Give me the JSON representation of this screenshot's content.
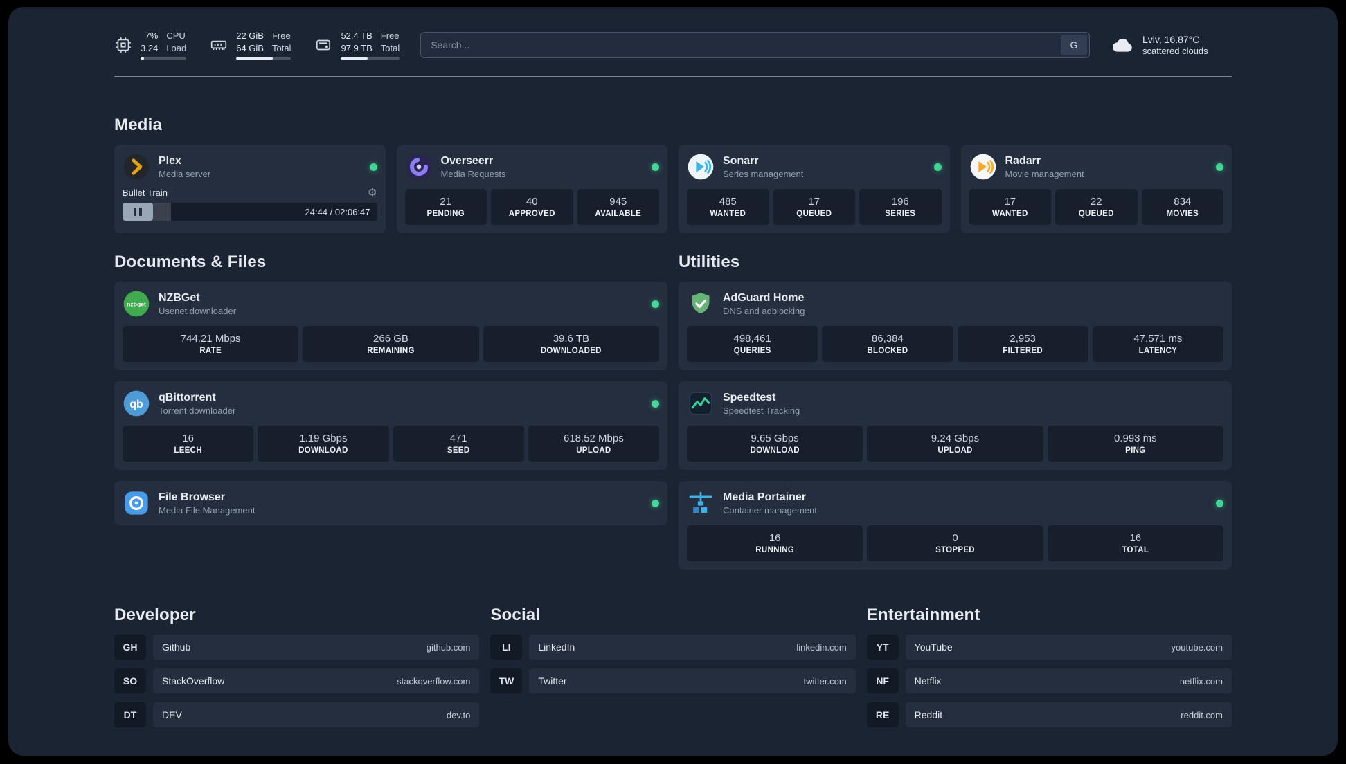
{
  "colors": {
    "online_dot": "#41d693",
    "plex_amber": "#e5a00d",
    "bar_fill": "#e9eef5"
  },
  "topbar": {
    "cpu": {
      "value_top": "7%",
      "value_bottom": "3.24",
      "label_top": "CPU",
      "label_bottom": "Load",
      "percent": 7
    },
    "memory": {
      "value_top": "22 GiB",
      "value_bottom": "64 GiB",
      "label_top": "Free",
      "label_bottom": "Total",
      "percent": 66
    },
    "disk": {
      "value_top": "52.4 TB",
      "value_bottom": "97.9 TB",
      "label_top": "Free",
      "label_bottom": "Total",
      "percent": 46
    },
    "search": {
      "placeholder": "Search...",
      "provider_label": "G"
    },
    "weather": {
      "location": "Lviv, 16.87°C",
      "condition": "scattered clouds"
    }
  },
  "sections": {
    "media": "Media",
    "documents": "Documents & Files",
    "utilities": "Utilities",
    "developer": "Developer",
    "social": "Social",
    "entertainment": "Entertainment"
  },
  "services": {
    "plex": {
      "name": "Plex",
      "desc": "Media server",
      "player": {
        "title": "Bullet Train",
        "time": "24:44 / 02:06:47",
        "progress": 19
      }
    },
    "overseerr": {
      "name": "Overseerr",
      "desc": "Media Requests",
      "stats": [
        {
          "value": "21",
          "label": "PENDING"
        },
        {
          "value": "40",
          "label": "APPROVED"
        },
        {
          "value": "945",
          "label": "AVAILABLE"
        }
      ]
    },
    "sonarr": {
      "name": "Sonarr",
      "desc": "Series management",
      "stats": [
        {
          "value": "485",
          "label": "WANTED"
        },
        {
          "value": "17",
          "label": "QUEUED"
        },
        {
          "value": "196",
          "label": "SERIES"
        }
      ]
    },
    "radarr": {
      "name": "Radarr",
      "desc": "Movie management",
      "stats": [
        {
          "value": "17",
          "label": "WANTED"
        },
        {
          "value": "22",
          "label": "QUEUED"
        },
        {
          "value": "834",
          "label": "MOVIES"
        }
      ]
    },
    "nzbget": {
      "name": "NZBGet",
      "desc": "Usenet downloader",
      "stats": [
        {
          "value": "744.21 Mbps",
          "label": "RATE"
        },
        {
          "value": "266 GB",
          "label": "REMAINING"
        },
        {
          "value": "39.6 TB",
          "label": "DOWNLOADED"
        }
      ]
    },
    "qbittorrent": {
      "name": "qBittorrent",
      "desc": "Torrent downloader",
      "stats": [
        {
          "value": "16",
          "label": "LEECH"
        },
        {
          "value": "1.19 Gbps",
          "label": "DOWNLOAD"
        },
        {
          "value": "471",
          "label": "SEED"
        },
        {
          "value": "618.52 Mbps",
          "label": "UPLOAD"
        }
      ]
    },
    "filebrowser": {
      "name": "File Browser",
      "desc": "Media File Management"
    },
    "adguard": {
      "name": "AdGuard Home",
      "desc": "DNS and adblocking",
      "stats": [
        {
          "value": "498,461",
          "label": "QUERIES"
        },
        {
          "value": "86,384",
          "label": "BLOCKED"
        },
        {
          "value": "2,953",
          "label": "FILTERED"
        },
        {
          "value": "47.571 ms",
          "label": "LATENCY"
        }
      ]
    },
    "speedtest": {
      "name": "Speedtest",
      "desc": "Speedtest Tracking",
      "stats": [
        {
          "value": "9.65 Gbps",
          "label": "DOWNLOAD"
        },
        {
          "value": "9.24 Gbps",
          "label": "UPLOAD"
        },
        {
          "value": "0.993 ms",
          "label": "PING"
        }
      ]
    },
    "portainer": {
      "name": "Media Portainer",
      "desc": "Container management",
      "stats": [
        {
          "value": "16",
          "label": "RUNNING"
        },
        {
          "value": "0",
          "label": "STOPPED"
        },
        {
          "value": "16",
          "label": "TOTAL"
        }
      ]
    }
  },
  "bookmarks": {
    "developer": [
      {
        "abbr": "GH",
        "name": "Github",
        "domain": "github.com"
      },
      {
        "abbr": "SO",
        "name": "StackOverflow",
        "domain": "stackoverflow.com"
      },
      {
        "abbr": "DT",
        "name": "DEV",
        "domain": "dev.to"
      }
    ],
    "social": [
      {
        "abbr": "LI",
        "name": "LinkedIn",
        "domain": "linkedin.com"
      },
      {
        "abbr": "TW",
        "name": "Twitter",
        "domain": "twitter.com"
      }
    ],
    "entertainment": [
      {
        "abbr": "YT",
        "name": "YouTube",
        "domain": "youtube.com"
      },
      {
        "abbr": "NF",
        "name": "Netflix",
        "domain": "netflix.com"
      },
      {
        "abbr": "RE",
        "name": "Reddit",
        "domain": "reddit.com"
      }
    ]
  }
}
